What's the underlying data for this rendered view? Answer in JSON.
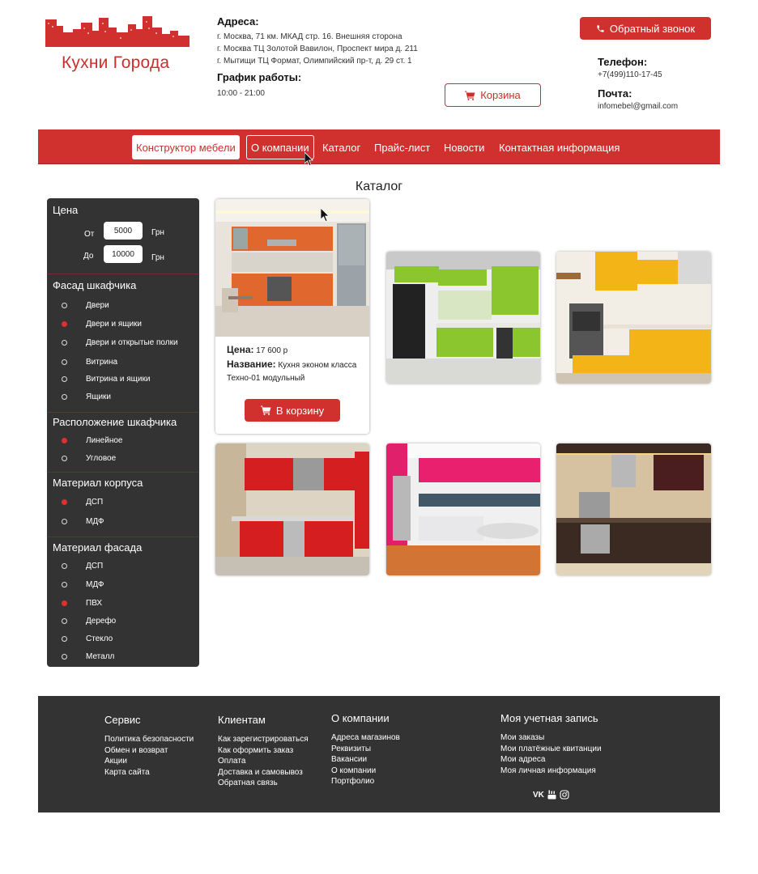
{
  "header": {
    "logo_text": "Кухни Города",
    "address_title": "Адреса:",
    "addresses": [
      "г. Москва, 71 км. МКАД стр. 16. Внешняя сторона",
      "г. Москва ТЦ Золотой Вавилон, Проспект мира д. 211",
      "г. Мытищи ТЦ Формат, Олимпийский пр-т, д. 29 ст. 1"
    ],
    "hours_title": "График работы:",
    "hours": "10:00 - 21:00",
    "callback_label": "Обратный звонок",
    "cart_label": "Корзина",
    "phone_title": "Телефон:",
    "phone": "+7(499)110-17-45",
    "email_title": "Почта:",
    "email": "infomebel@gmail.com"
  },
  "nav": [
    "Конструктор мебели",
    "О компании",
    "Каталог",
    "Прайс-лист",
    "Новости",
    "Контактная информация"
  ],
  "catalog": {
    "title": "Каталог",
    "featured": {
      "price_label": "Цена:",
      "price": "17 600 р",
      "name_label": "Название:",
      "name": "Кухня эконом класса Техно-01 модульный",
      "button": "В корзину"
    }
  },
  "sidebar": {
    "price": {
      "title": "Цена",
      "from_label": "От",
      "from_value": "5000",
      "to_label": "До",
      "to_value": "10000",
      "currency": "Грн"
    },
    "facade": {
      "title": "Фасад шкафчика",
      "options": [
        "Двери",
        "Двери и ящики",
        "Двери и открытые полки",
        "Витрина",
        "Витрина и ящики",
        "Ящики"
      ],
      "selected": 1
    },
    "layout": {
      "title": "Расположение шкафчика",
      "options": [
        "Линейное",
        "Угловое"
      ],
      "selected": 0
    },
    "body_material": {
      "title": "Материал корпуса",
      "options": [
        "ДСП",
        "МДФ"
      ],
      "selected": 0
    },
    "facade_material": {
      "title": "Материал фасада",
      "options": [
        "ДСП",
        "МДФ",
        "ПВХ",
        "Дерефо",
        "Стекло",
        "Металл"
      ],
      "selected": 2
    }
  },
  "footer": {
    "columns": [
      {
        "title": "Сервис",
        "links": [
          "Политика безопасности",
          "Обмен и возврат",
          "Акции",
          "Карта сайта"
        ]
      },
      {
        "title": "Клиентам",
        "links": [
          "Как зарегистрироваться",
          "Как оформить заказ",
          "Оплата",
          "Доставка и самовывоз",
          "Обратная связь"
        ]
      },
      {
        "title": "О компании",
        "links": [
          "Адреса магазинов",
          "Реквизиты",
          "Вакансии",
          "О компании",
          "Портфолио"
        ]
      },
      {
        "title": "Моя учетная запись",
        "links": [
          "Мои заказы",
          "Мои платёжные квитанции",
          "Мои адреса",
          "Моя личная информация"
        ]
      }
    ],
    "social_icons": [
      "vk-icon",
      "youtube-icon",
      "instagram-icon"
    ],
    "social_vk_text": "VK"
  },
  "colors": {
    "brand_red": "#d0302e",
    "sidebar_bg": "#333333",
    "footer_bg": "#333333"
  }
}
